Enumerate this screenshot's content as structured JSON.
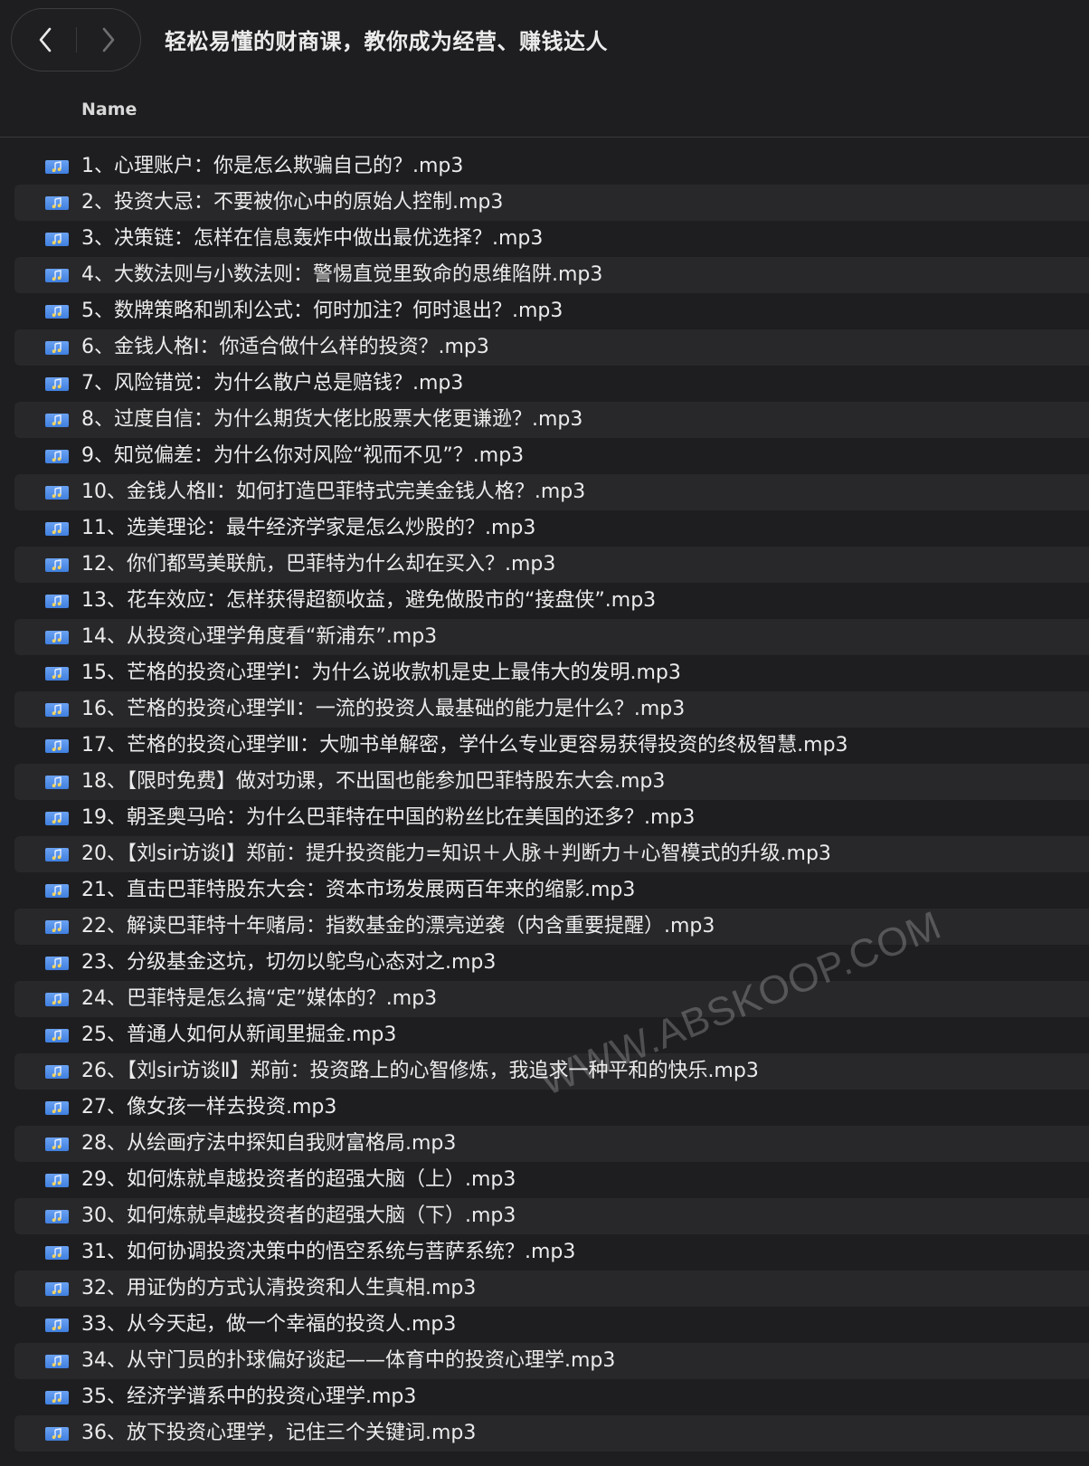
{
  "window": {
    "title": "轻松易懂的财商课，教你成为经营、赚钱达人"
  },
  "columns": {
    "name": "Name"
  },
  "files": [
    "1、心理账户：你是怎么欺骗自己的？.mp3",
    "2、投资大忌：不要被你心中的原始人控制.mp3",
    "3、决策链：怎样在信息轰炸中做出最优选择？.mp3",
    "4、大数法则与小数法则：警惕直觉里致命的思维陷阱.mp3",
    "5、数牌策略和凯利公式：何时加注？何时退出？.mp3",
    "6、金钱人格Ⅰ：你适合做什么样的投资？.mp3",
    "7、风险错觉：为什么散户总是赔钱？.mp3",
    "8、过度自信：为什么期货大佬比股票大佬更谦逊？.mp3",
    "9、知觉偏差：为什么你对风险“视而不见”？.mp3",
    "10、金钱人格Ⅱ：如何打造巴菲特式完美金钱人格？.mp3",
    "11、选美理论：最牛经济学家是怎么炒股的？.mp3",
    "12、你们都骂美联航，巴菲特为什么却在买入？.mp3",
    "13、花车效应：怎样获得超额收益，避免做股市的“接盘侠”.mp3",
    "14、从投资心理学角度看“新浦东”.mp3",
    "15、芒格的投资心理学Ⅰ：为什么说收款机是史上最伟大的发明.mp3",
    "16、芒格的投资心理学Ⅱ：一流的投资人最基础的能力是什么？.mp3",
    "17、芒格的投资心理学Ⅲ：大咖书单解密，学什么专业更容易获得投资的终极智慧.mp3",
    "18、【限时免费】做对功课，不出国也能参加巴菲特股东大会.mp3",
    "19、朝圣奥马哈：为什么巴菲特在中国的粉丝比在美国的还多？.mp3",
    "20、【刘sir访谈Ⅰ】郑前：提升投资能力=知识＋人脉＋判断力＋心智模式的升级.mp3",
    "21、直击巴菲特股东大会：资本市场发展两百年来的缩影.mp3",
    "22、解读巴菲特十年赌局：指数基金的漂亮逆袭（内含重要提醒）.mp3",
    "23、分级基金这坑，切勿以鸵鸟心态对之.mp3",
    "24、巴菲特是怎么搞“定”媒体的？.mp3",
    "25、普通人如何从新闻里掘金.mp3",
    "26、【刘sir访谈Ⅱ】郑前：投资路上的心智修炼，我追求一种平和的快乐.mp3",
    "27、像女孩一样去投资.mp3",
    "28、从绘画疗法中探知自我财富格局.mp3",
    "29、如何炼就卓越投资者的超强大脑（上）.mp3",
    "30、如何炼就卓越投资者的超强大脑（下）.mp3",
    "31、如何协调投资决策中的悟空系统与菩萨系统？.mp3",
    "32、用证伪的方式认清投资和人生真相.mp3",
    "33、从今天起，做一个幸福的投资人.mp3",
    "34、从守门员的扑球偏好谈起——体育中的投资心理学.mp3",
    "35、经济学谱系中的投资心理学.mp3",
    "36、放下投资心理学，记住三个关键词.mp3"
  ],
  "watermark": "WWW.ABSKOOP.COM",
  "colors": {
    "background": "#1e1e21",
    "stripe": "#28282b",
    "icon": "#4f8ff0"
  },
  "icons": {
    "back": "chevron-left-icon",
    "forward": "chevron-right-icon",
    "file": "audio-file-icon"
  }
}
